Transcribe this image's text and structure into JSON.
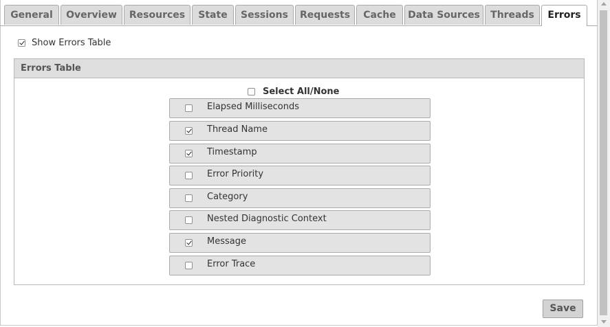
{
  "tabs": [
    {
      "label": "General",
      "active": false
    },
    {
      "label": "Overview",
      "active": false
    },
    {
      "label": "Resources",
      "active": false
    },
    {
      "label": "State",
      "active": false
    },
    {
      "label": "Sessions",
      "active": false
    },
    {
      "label": "Requests",
      "active": false
    },
    {
      "label": "Cache",
      "active": false
    },
    {
      "label": "Data Sources",
      "active": false
    },
    {
      "label": "Threads",
      "active": false
    },
    {
      "label": "Errors",
      "active": true
    }
  ],
  "show_errors": {
    "label": "Show Errors Table",
    "checked": true
  },
  "panel": {
    "title": "Errors Table",
    "select_all": {
      "label": "Select All/None",
      "checked": false
    },
    "fields": [
      {
        "label": "Elapsed Milliseconds",
        "checked": false
      },
      {
        "label": "Thread Name",
        "checked": true
      },
      {
        "label": "Timestamp",
        "checked": true
      },
      {
        "label": "Error Priority",
        "checked": false
      },
      {
        "label": "Category",
        "checked": false
      },
      {
        "label": "Nested Diagnostic Context",
        "checked": false
      },
      {
        "label": "Message",
        "checked": true
      },
      {
        "label": "Error Trace",
        "checked": false
      }
    ]
  },
  "save_label": "Save"
}
